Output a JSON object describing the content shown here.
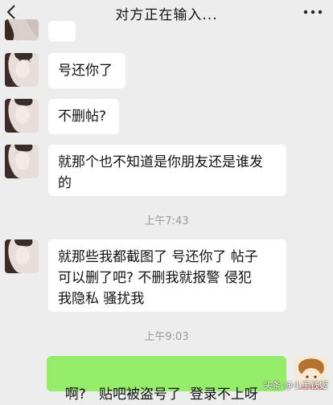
{
  "header": {
    "title": "对方正在输入...",
    "back_icon": "chevron-left-icon",
    "more_icon": "more-dots-icon"
  },
  "messages": [
    {
      "from": "other",
      "text": "号还你了"
    },
    {
      "from": "other",
      "text": "不删帖?"
    },
    {
      "from": "other",
      "lines": [
        "就那个也不知道是你朋友还是谁发",
        "的"
      ]
    },
    {
      "time": "上午7:43"
    },
    {
      "from": "other",
      "lines": [
        "就那些我都截图了  号还你了  帖子",
        "可以删了吧?  不删我就报警  侵犯",
        "我隐私  骚扰我"
      ]
    },
    {
      "time": "上午9:03"
    },
    {
      "from": "me",
      "text": "啊?   贴吧被盗号了  登录不上呀"
    }
  ],
  "watermark": "头条 @小手钱姬",
  "colors": {
    "background": "#ededed",
    "bubble_other": "#ffffff",
    "bubble_me": "#95ec69",
    "time_text": "#999999"
  }
}
